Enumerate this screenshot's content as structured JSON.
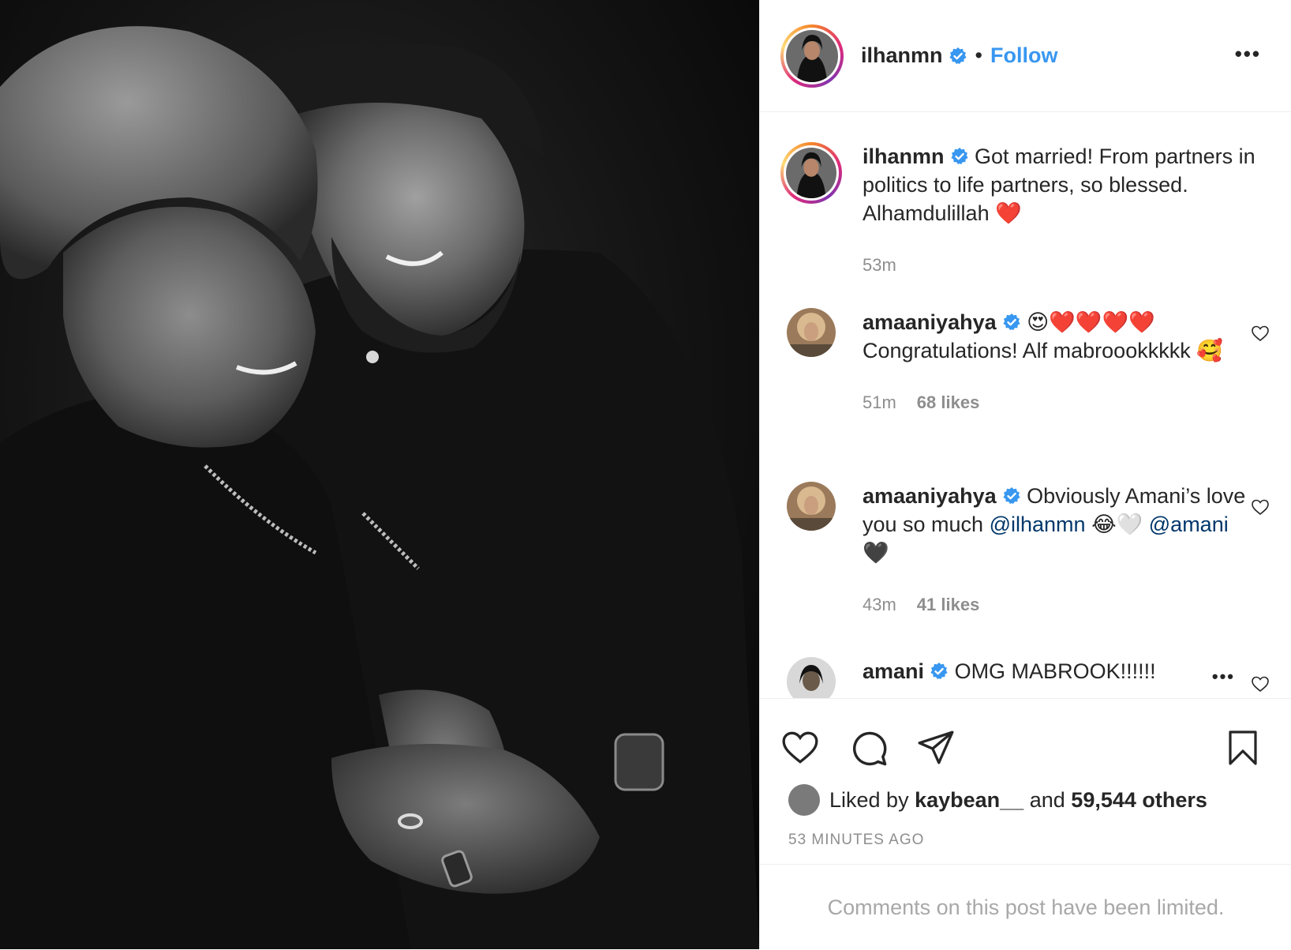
{
  "post": {
    "author": "ilhanmn",
    "follow_label": "Follow",
    "separator": "•",
    "more_label": "•••"
  },
  "caption": {
    "username": "ilhanmn",
    "text": "Got married! From partners in politics to life partners, so blessed. Alhamdulillah",
    "emoji": "❤️",
    "time": "53m"
  },
  "comments": [
    {
      "username": "amaaniyahya",
      "emoji_prefix": "😍❤️❤️❤️❤️",
      "text": "Congratulations! Alf mabroookkkkk",
      "emoji_suffix": "🥰",
      "time": "51m",
      "likes": "68 likes"
    },
    {
      "username": "amaaniyahya",
      "text_a": "Obviously Amani’s love you so much",
      "mention_a": "@ilhanmn",
      "emoji_a": "😂🤍",
      "mention_b": "@amani",
      "emoji_b": "🖤",
      "time": "43m",
      "likes": "41 likes"
    },
    {
      "username": "amani",
      "text": "OMG MABROOK!!!!!!",
      "more": "•••"
    }
  ],
  "liked_by": {
    "prefix": "Liked by",
    "user": "kaybean__",
    "conj": "and",
    "others": "59,544 others"
  },
  "timestamp": "53 MINUTES AGO",
  "limited_notice": "Comments on this post have been limited.",
  "colors": {
    "accent": "#3897f0",
    "mention": "#00376b",
    "muted": "#8e8e8e",
    "heart": "#ed4956"
  },
  "icons": [
    "verified-badge-icon",
    "heart-icon",
    "comment-icon",
    "share-icon",
    "bookmark-icon",
    "more-icon"
  ]
}
